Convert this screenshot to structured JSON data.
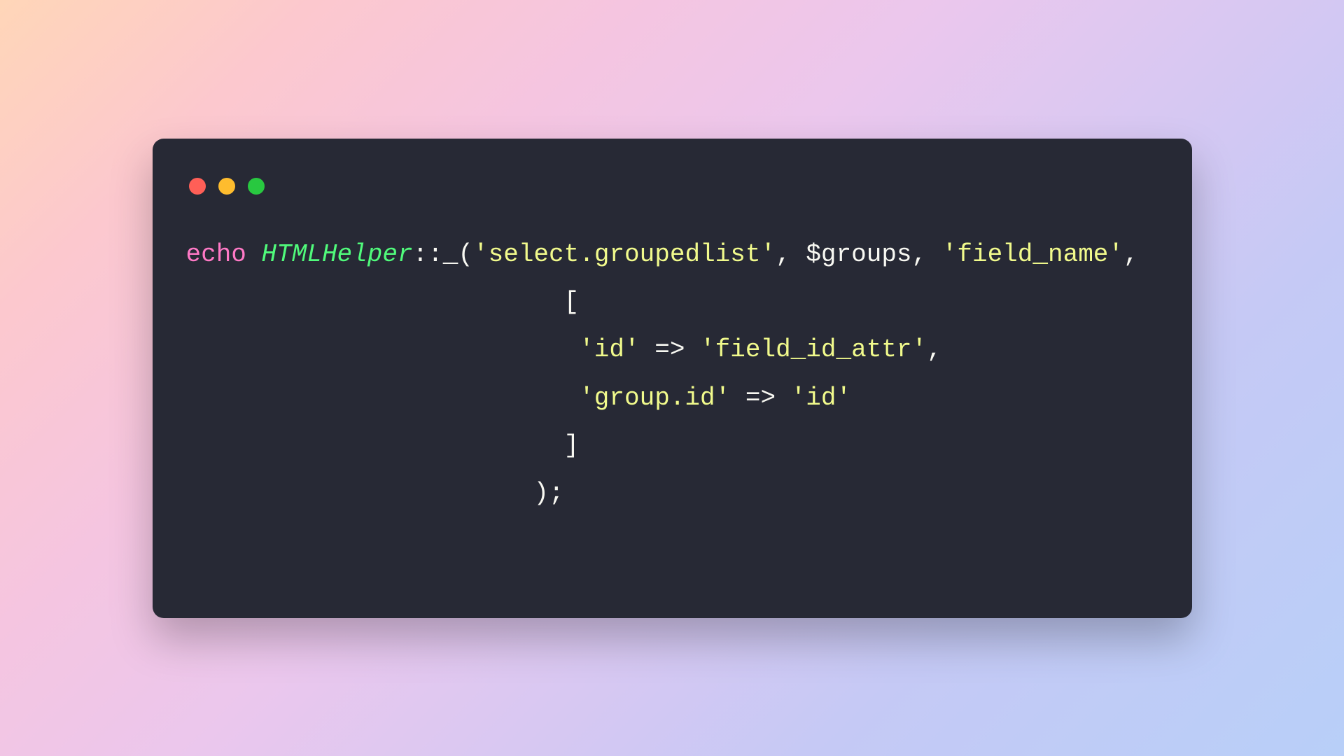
{
  "code": {
    "line1": {
      "keyword_echo": "echo",
      "space1": " ",
      "class_name": "HTMLHelper",
      "scope_op": "::",
      "fn_underscore": "_",
      "paren_open": "(",
      "str1": "'select.groupedlist'",
      "comma1": ",",
      "space2": " ",
      "var_groups": "$groups",
      "comma2": ",",
      "space3": " ",
      "str_fieldname": "'field_name'",
      "comma3": ","
    },
    "line2": {
      "indent": "                         ",
      "bracket_open": "["
    },
    "line3": {
      "indent": "                          ",
      "str_id": "'id'",
      "space1": " ",
      "arrow": "=>",
      "space2": " ",
      "str_field_id": "'field_id_attr'",
      "comma": ","
    },
    "line4": {
      "indent": "                          ",
      "str_group_id": "'group.id'",
      "space1": " ",
      "arrow": "=>",
      "space2": " ",
      "str_id_val": "'id'"
    },
    "line5": {
      "indent": "                         ",
      "bracket_close": "]"
    },
    "line6": {
      "indent": "                       ",
      "paren_close": ")",
      "semi": ";"
    }
  }
}
